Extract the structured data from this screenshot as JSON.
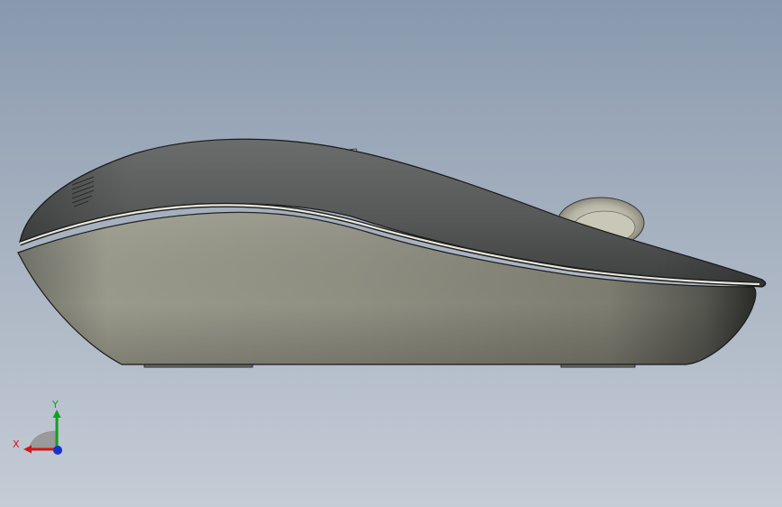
{
  "viewport": {
    "model_name": "wireless-mouse",
    "view": "side",
    "background_top": "#8899ad",
    "background_bottom": "#c4ccd6"
  },
  "triad": {
    "x_label": "X",
    "y_label": "Y",
    "x_color": "#d01818",
    "y_color": "#10a020",
    "z_color": "#1830d0"
  }
}
